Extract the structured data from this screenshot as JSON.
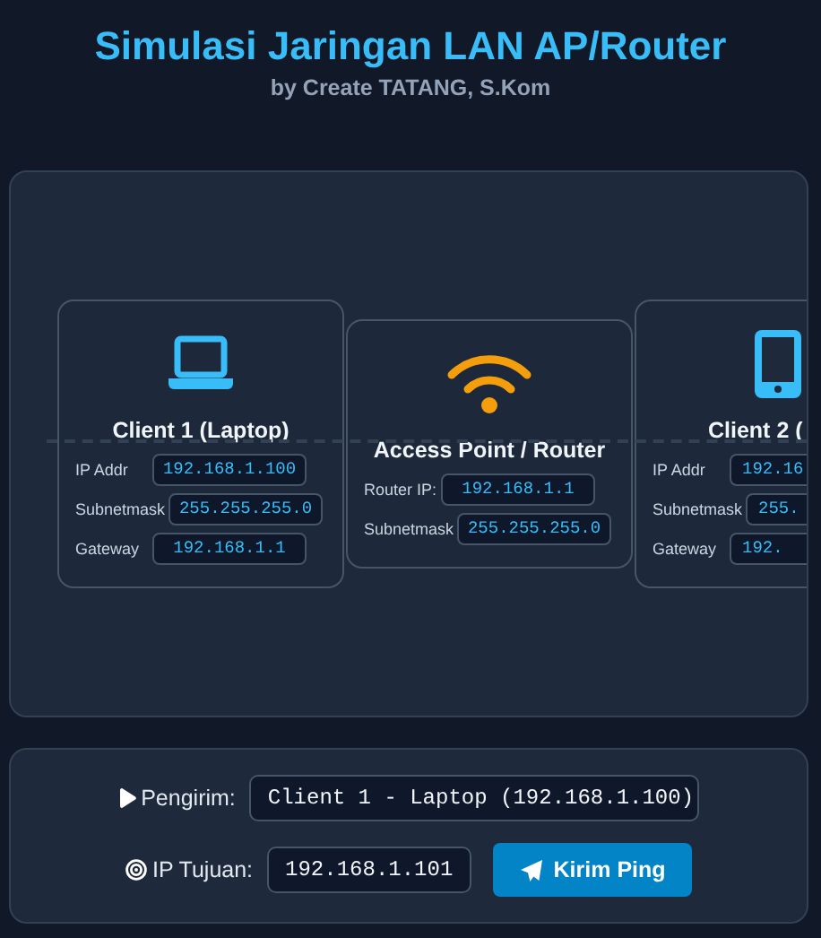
{
  "header": {
    "title": "Simulasi Jaringan LAN AP/Router",
    "subtitle": "by Create TATANG, S.Kom"
  },
  "nodes": [
    {
      "kind": "laptop",
      "name": "Client 1 (Laptop)",
      "fields": [
        {
          "label": "IP Addr",
          "value": "192.168.1.100"
        },
        {
          "label": "Subnetmask",
          "value": "255.255.255.0"
        },
        {
          "label": "Gateway",
          "value": "192.168.1.1"
        }
      ]
    },
    {
      "kind": "router",
      "name": "Access Point / Router",
      "fields": [
        {
          "label": "Router IP:",
          "value": "192.168.1.1"
        },
        {
          "label": "Subnetmask",
          "value": "255.255.255.0"
        }
      ]
    },
    {
      "kind": "phone",
      "name": "Client 2 (",
      "fields": [
        {
          "label": "IP Addr",
          "value": "192.16"
        },
        {
          "label": "Subnetmask",
          "value": "255."
        },
        {
          "label": "Gateway",
          "value": "192."
        }
      ]
    }
  ],
  "controls": {
    "sender": {
      "label": "Pengirim:",
      "value": "Client 1 - Laptop (192.168.1.100)"
    },
    "target": {
      "label": "IP Tujuan:",
      "value": "192.168.1.101"
    },
    "button": {
      "label": "Kirim Ping"
    }
  }
}
